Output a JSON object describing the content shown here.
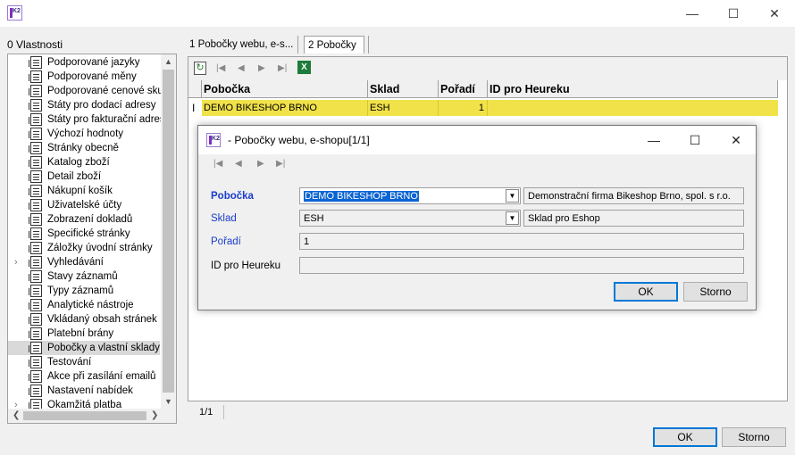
{
  "window": {
    "minimize_icon": "minimize-icon",
    "maximize_icon": "maximize-icon",
    "close_icon": "close-icon",
    "minimize": "—",
    "maximize": "☐",
    "close": "✕"
  },
  "left_panel": {
    "label": "0 Vlastnosti",
    "items": [
      {
        "label": "Podporované jazyky",
        "expandable": false
      },
      {
        "label": "Podporované měny",
        "expandable": false
      },
      {
        "label": "Podporované cenové skup",
        "expandable": false
      },
      {
        "label": "Státy pro dodací adresy",
        "expandable": false
      },
      {
        "label": "Státy pro fakturační adres",
        "expandable": false
      },
      {
        "label": "Výchozí hodnoty",
        "expandable": false
      },
      {
        "label": "Stránky obecně",
        "expandable": false
      },
      {
        "label": "Katalog zboží",
        "expandable": false
      },
      {
        "label": "Detail zboží",
        "expandable": false
      },
      {
        "label": "Nákupní košík",
        "expandable": false
      },
      {
        "label": "Uživatelské účty",
        "expandable": false
      },
      {
        "label": "Zobrazení dokladů",
        "expandable": false
      },
      {
        "label": "Specifické stránky",
        "expandable": false
      },
      {
        "label": "Záložky úvodní stránky",
        "expandable": false
      },
      {
        "label": "Vyhledávání",
        "expandable": true
      },
      {
        "label": "Stavy záznamů",
        "expandable": false
      },
      {
        "label": "Typy záznamů",
        "expandable": false
      },
      {
        "label": "Analytické nástroje",
        "expandable": false
      },
      {
        "label": "Vkládaný obsah stránek",
        "expandable": false
      },
      {
        "label": "Platební brány",
        "expandable": false
      },
      {
        "label": "Pobočky a vlastní sklady",
        "expandable": false,
        "selected": true
      },
      {
        "label": "Testování",
        "expandable": false
      },
      {
        "label": "Akce při zasílání emailů",
        "expandable": false
      },
      {
        "label": "Nastavení nabídek",
        "expandable": false
      },
      {
        "label": "Okamžitá platba",
        "expandable": true
      }
    ],
    "scroll_up": "▲",
    "scroll_down": "▼",
    "scroll_left": "❮",
    "scroll_right": "❯"
  },
  "tabs": [
    {
      "label": "1 Pobočky webu, e-s...",
      "active": false
    },
    {
      "label": "2 Pobočky",
      "active": true
    }
  ],
  "grid": {
    "toolbar": [
      "refresh-icon",
      "first-record-icon",
      "previous-record-icon",
      "next-record-icon",
      "last-record-icon",
      "excel-export-icon"
    ],
    "nav_first": "|◀",
    "nav_prev": "◀",
    "nav_next": "▶",
    "nav_last": "▶|",
    "columns": [
      "Pobočka",
      "Sklad",
      "Pořadí",
      "ID pro Heureku"
    ],
    "rows": [
      [
        "DEMO BIKESHOP BRNO",
        "ESH",
        "1",
        ""
      ]
    ],
    "row_marker": "I",
    "status": "1/1"
  },
  "dialog": {
    "title": "- Pobočky webu, e-shopu[1/1]",
    "fields": {
      "pobocka": {
        "label": "Pobočka",
        "value": "DEMO BIKESHOP BRNO",
        "description": "Demonstrační firma Bikeshop Brno, spol. s r.o."
      },
      "sklad": {
        "label": "Sklad",
        "value": "ESH",
        "description": "Sklad pro Eshop"
      },
      "poradi": {
        "label": "Pořadí",
        "value": "1"
      },
      "heureka": {
        "label": "ID pro Heureku",
        "value": ""
      }
    },
    "ok": "OK",
    "cancel": "Storno"
  },
  "footer": {
    "ok": "OK",
    "cancel": "Storno"
  },
  "colors": {
    "selected_row": "#f2e24a",
    "label_blue": "#1a3ccc",
    "text_selection": "#0a64d2",
    "default_button_border": "#0078d7"
  }
}
